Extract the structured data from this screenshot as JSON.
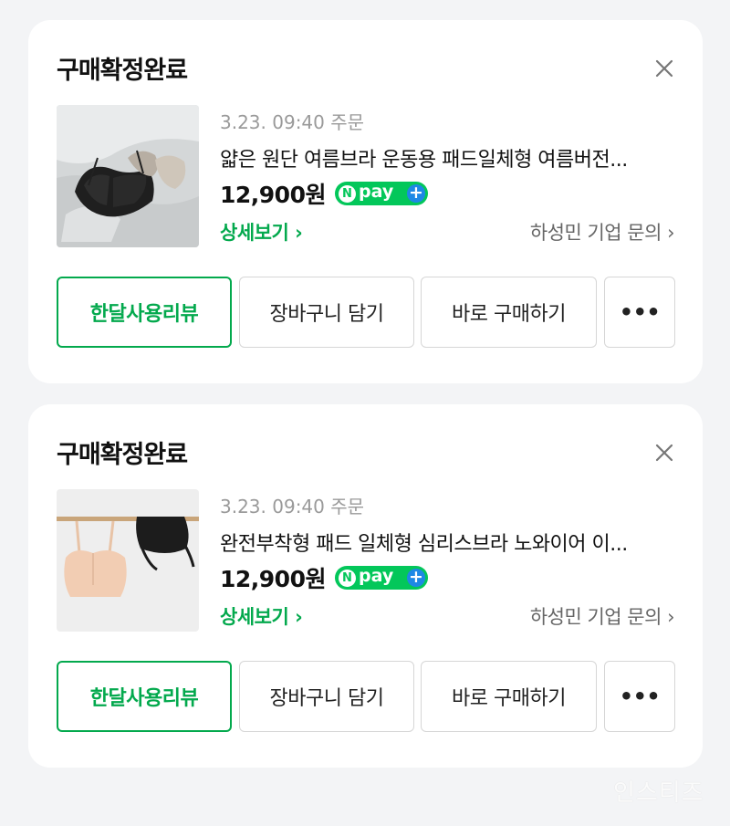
{
  "orders": [
    {
      "status": "구매확정완료",
      "date": "3.23. 09:40 주문",
      "title": "얇은 원단 여름브라 운동용 패드일체형 여름버전...",
      "price": "12,900원",
      "npay": "pay",
      "detail_link": "상세보기 ›",
      "inquiry_link": "하성민 기업 문의 ›",
      "buttons": {
        "review": "한달사용리뷰",
        "cart": "장바구니 담기",
        "buy": "바로 구매하기",
        "more": "•••"
      }
    },
    {
      "status": "구매확정완료",
      "date": "3.23. 09:40 주문",
      "title": "완전부착형 패드 일체형 심리스브라 노와이어 이...",
      "price": "12,900원",
      "npay": "pay",
      "detail_link": "상세보기 ›",
      "inquiry_link": "하성민 기업 문의 ›",
      "buttons": {
        "review": "한달사용리뷰",
        "cart": "장바구니 담기",
        "buy": "바로 구매하기",
        "more": "•••"
      }
    }
  ],
  "watermark": "인스티즈",
  "colors": {
    "accent_green": "#03a94d",
    "npay_green": "#03c75a",
    "npay_blue": "#1e88e5",
    "background": "#f3f4f6"
  },
  "icons": [
    "close-icon",
    "npay-logo",
    "more-icon"
  ]
}
